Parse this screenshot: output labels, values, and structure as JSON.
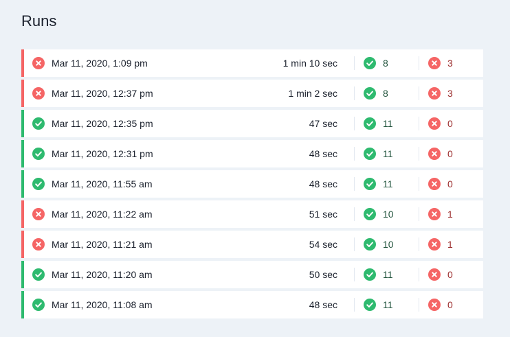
{
  "page": {
    "title": "Runs"
  },
  "colors": {
    "failed": "#f56565",
    "passed": "#2eba6f",
    "pass_count_text": "#22543d",
    "fail_count_text": "#9b2c2c"
  },
  "icons": {
    "passed": "check-circle-icon",
    "failed": "x-circle-icon"
  },
  "runs": [
    {
      "status": "failed",
      "date": "Mar 11, 2020, 1:09 pm",
      "duration": "1 min 10 sec",
      "passed": "8",
      "failed": "3"
    },
    {
      "status": "failed",
      "date": "Mar 11, 2020, 12:37 pm",
      "duration": "1 min 2 sec",
      "passed": "8",
      "failed": "3"
    },
    {
      "status": "passed",
      "date": "Mar 11, 2020, 12:35 pm",
      "duration": "47 sec",
      "passed": "11",
      "failed": "0"
    },
    {
      "status": "passed",
      "date": "Mar 11, 2020, 12:31 pm",
      "duration": "48 sec",
      "passed": "11",
      "failed": "0"
    },
    {
      "status": "passed",
      "date": "Mar 11, 2020, 11:55 am",
      "duration": "48 sec",
      "passed": "11",
      "failed": "0"
    },
    {
      "status": "failed",
      "date": "Mar 11, 2020, 11:22 am",
      "duration": "51 sec",
      "passed": "10",
      "failed": "1"
    },
    {
      "status": "failed",
      "date": "Mar 11, 2020, 11:21 am",
      "duration": "54 sec",
      "passed": "10",
      "failed": "1"
    },
    {
      "status": "passed",
      "date": "Mar 11, 2020, 11:20 am",
      "duration": "50 sec",
      "passed": "11",
      "failed": "0"
    },
    {
      "status": "passed",
      "date": "Mar 11, 2020, 11:08 am",
      "duration": "48 sec",
      "passed": "11",
      "failed": "0"
    }
  ]
}
